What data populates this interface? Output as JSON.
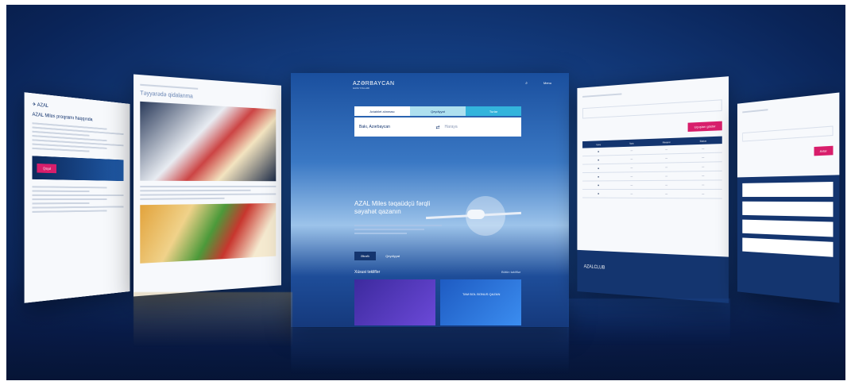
{
  "center": {
    "logo": "AZƏRBAYCAN",
    "logo_sub": "HAVA YOLLARI",
    "nav_menu": "Menu",
    "tabs": [
      "Aviabilet alınması",
      "Qeydiyyat",
      "Turlar"
    ],
    "from_city": "Bakı, Azərbaycan",
    "to_city": "Haraya",
    "hero_title": "AZAL Miles təqaüdçü fərqli səyahət qazanın",
    "hero_btn_1": "Ətraflı",
    "hero_btn_2": "Qeydiyyat",
    "section_title": "Xüsusi təkliflər",
    "section_link": "Bütün təkliflər",
    "promo_text": "TAM BOL BONUS QAZAN"
  },
  "left_page": {
    "title": "AZAL Miles proqramı haqqında",
    "red_button": "Qoşul"
  },
  "second_page": {
    "title": "Təyyarədə qidalanma"
  },
  "right_page": {
    "cta": "Uçuşları göstər",
    "table_headers": [
      "Uçuş",
      "Tarix",
      "Marşrut",
      "Status"
    ],
    "club_logo": "AZALCLUB"
  },
  "far_right_page": {
    "cta": "Axtar"
  },
  "colors": {
    "brand_navy": "#14356f",
    "brand_pink": "#d81e6b",
    "sky_blue": "#3a78c4"
  }
}
